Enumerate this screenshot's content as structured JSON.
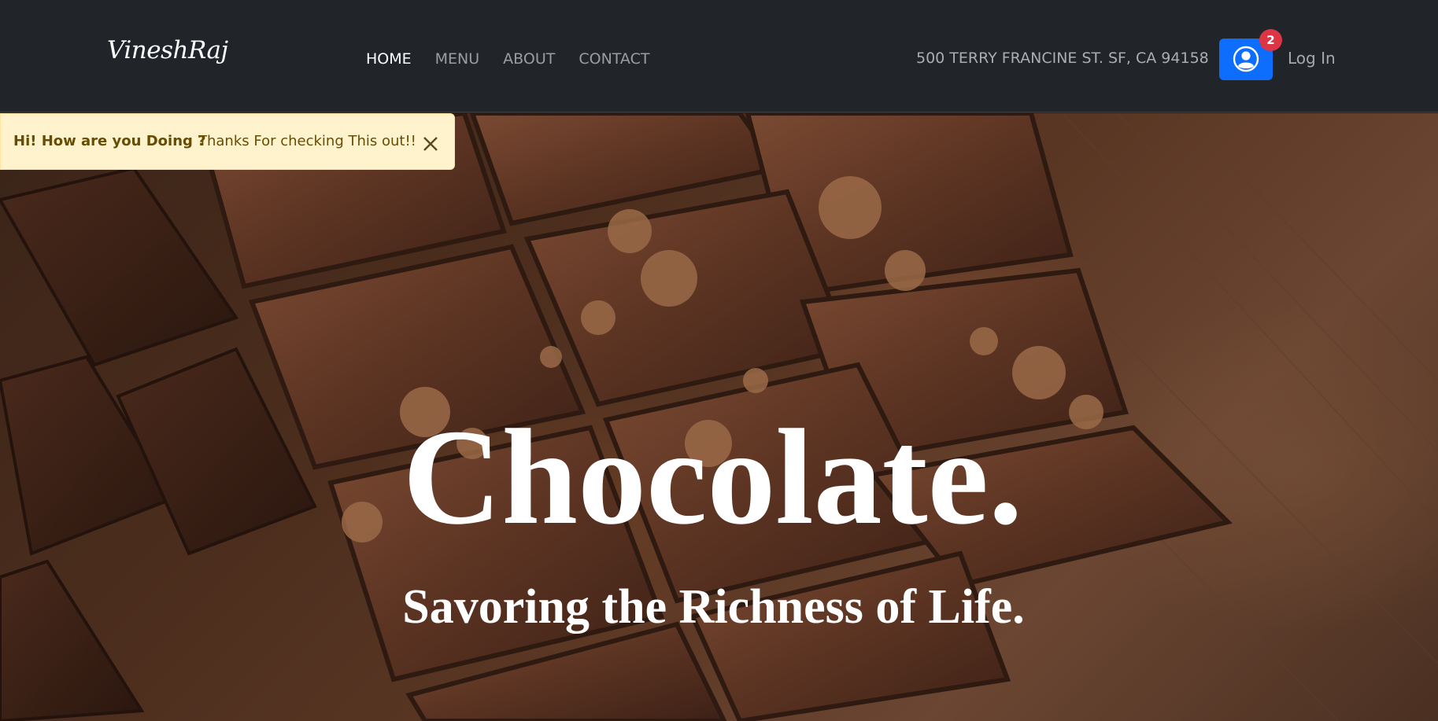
{
  "navbar": {
    "brand": "VineshRaj",
    "links": [
      {
        "label": "HOME",
        "active": true
      },
      {
        "label": "MENU",
        "active": false
      },
      {
        "label": "ABOUT",
        "active": false
      },
      {
        "label": "CONTACT",
        "active": false
      }
    ],
    "address": "500 TERRY FRANCINE ST. SF, CA 94158",
    "profile_icon": "user-circle-icon",
    "notification_count": "2",
    "login_label": "Log In"
  },
  "alert": {
    "strong": "Hi! How are you Doing ?",
    "text": "Thanks For checking This out!!",
    "close_icon": "close-icon"
  },
  "hero": {
    "title": "Chocolate.",
    "subtitle": "Savoring the Richness of Life."
  },
  "colors": {
    "navbar_bg": "#212529",
    "primary": "#0d6efd",
    "badge": "#dc3545",
    "alert_bg": "#fff3cd",
    "alert_text": "#664d03"
  }
}
